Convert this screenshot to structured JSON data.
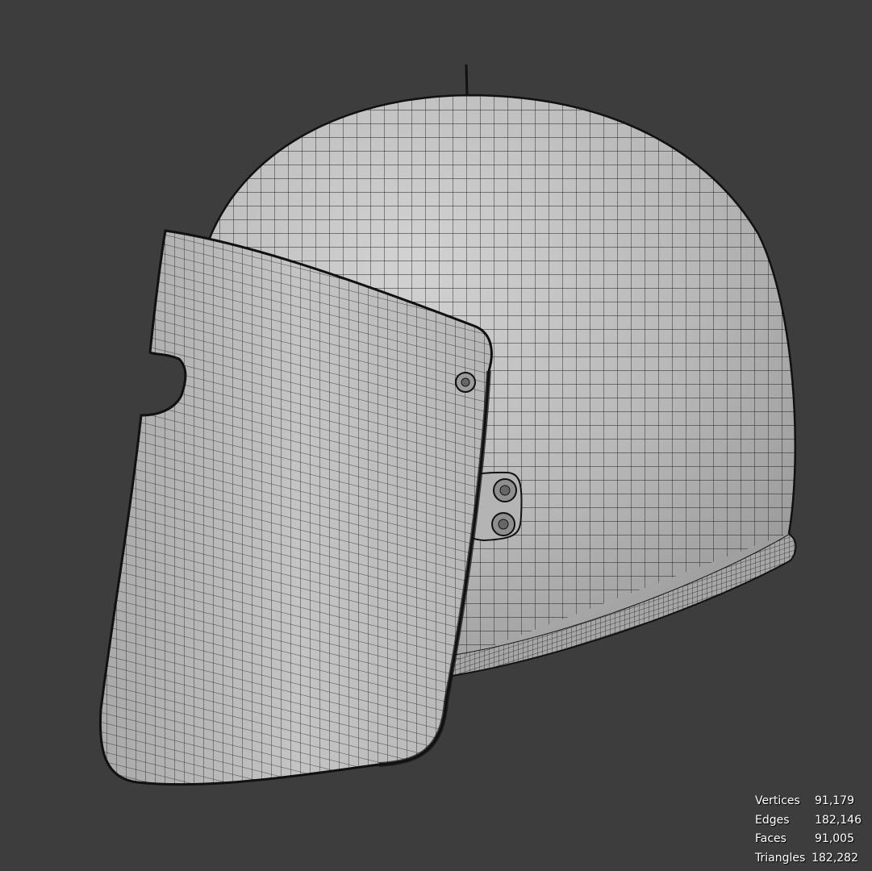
{
  "viewport": {
    "background": "#3d3d3d",
    "model": "helmet-with-visor",
    "shading": "solid-with-wireframe",
    "mesh_color": "#bdbdbd",
    "wire_color": "#1e1e1e"
  },
  "stats": [
    {
      "label": "Vertices",
      "value": "91,179"
    },
    {
      "label": "Edges",
      "value": "182,146"
    },
    {
      "label": "Faces",
      "value": "91,005"
    },
    {
      "label": "Triangles",
      "value": "182,282"
    }
  ]
}
